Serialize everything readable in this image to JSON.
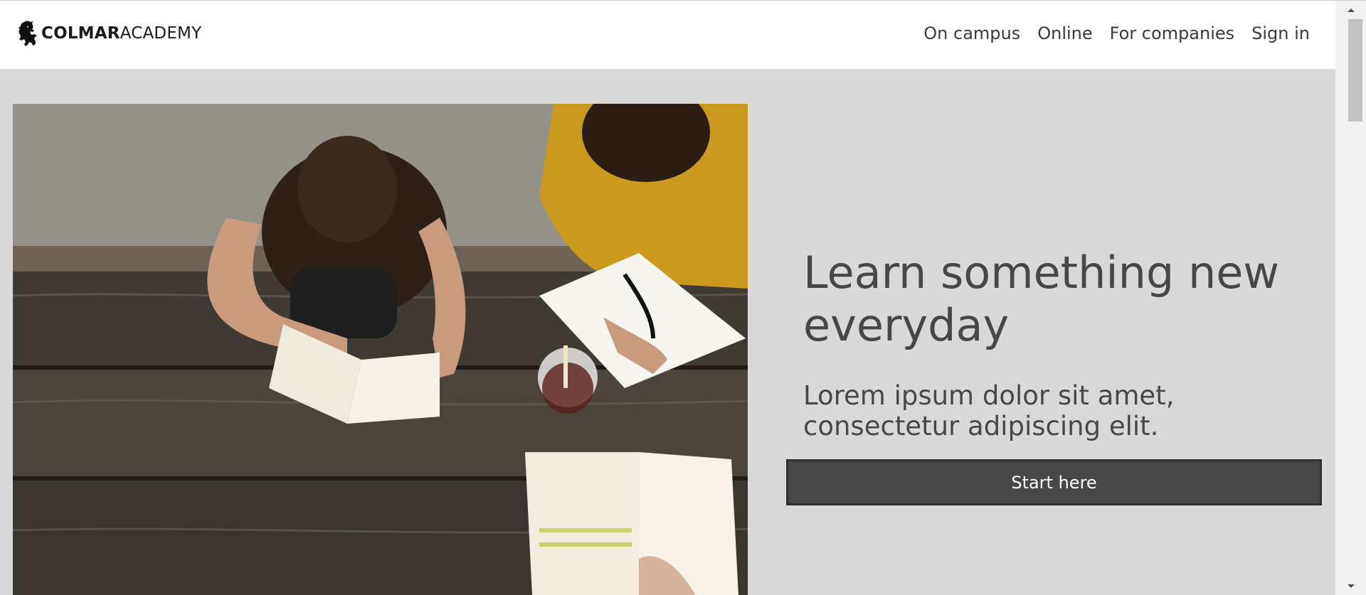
{
  "header": {
    "logo_bold": "COLMAR",
    "logo_light": "ACADEMY",
    "logo_icon": "lion-rampant-icon",
    "nav": [
      {
        "label": "On campus"
      },
      {
        "label": "Online"
      },
      {
        "label": "For companies"
      },
      {
        "label": "Sign in"
      }
    ]
  },
  "hero": {
    "image": "students-studying-at-picnic-table",
    "headline": "Learn something new everyday",
    "subline": "Lorem ipsum dolor sit amet, consectetur adipiscing elit.",
    "cta_label": "Start here"
  },
  "scrollbar": {
    "up_icon": "scroll-up-arrow-icon",
    "down_icon": "scroll-down-arrow-icon"
  },
  "colors": {
    "hero_bg": "#d9d9d9",
    "text_dark": "#474747",
    "button_bg": "#474747",
    "button_text": "#ffffff"
  }
}
